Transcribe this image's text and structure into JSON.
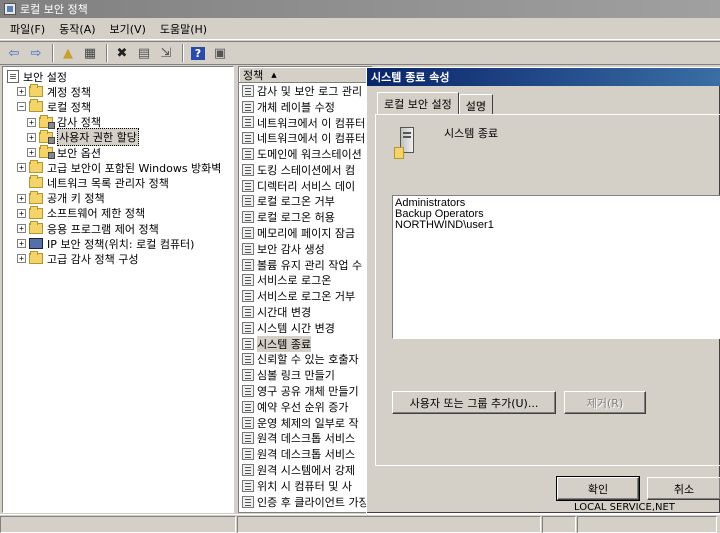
{
  "window": {
    "title": "로컬 보안 정책"
  },
  "menu": [
    "파일(F)",
    "동작(A)",
    "보기(V)",
    "도움말(H)"
  ],
  "toolbar": {
    "buttons": [
      {
        "icon": "back-arrow-icon",
        "glyph": "⇦",
        "color": "#3b6cc4"
      },
      {
        "icon": "forward-arrow-icon",
        "glyph": "⇨",
        "color": "#3b6cc4"
      },
      {
        "icon": "up-folder-icon",
        "glyph": "▲",
        "color": "#c8a030"
      },
      {
        "icon": "show-hide-tree-icon",
        "glyph": "▦",
        "color": "#444444"
      },
      {
        "icon": "delete-icon",
        "glyph": "✖",
        "color": "#222222"
      },
      {
        "icon": "properties-icon",
        "glyph": "▤",
        "color": "#555555"
      },
      {
        "icon": "export-list-icon",
        "glyph": "⇲",
        "color": "#555555"
      },
      {
        "icon": "help-icon",
        "glyph": "?",
        "color": "#ffffff"
      },
      {
        "icon": "console-icon",
        "glyph": "▣",
        "color": "#555555"
      }
    ]
  },
  "tree": {
    "items": [
      {
        "label": "보안 설정",
        "expander": "",
        "icon": "doc",
        "level": 0
      },
      {
        "label": "계정 정책",
        "expander": "+",
        "icon": "folder",
        "level": 1
      },
      {
        "label": "로컬 정책",
        "expander": "−",
        "icon": "folder",
        "level": 1
      },
      {
        "label": "감사 정책",
        "expander": "+",
        "icon": "lock-folder",
        "level": 2
      },
      {
        "label": "사용자 권한 할당",
        "expander": "+",
        "icon": "lock-folder",
        "level": 2,
        "selected": true
      },
      {
        "label": "보안 옵션",
        "expander": "+",
        "icon": "lock-folder",
        "level": 2
      },
      {
        "label": "고급 보안이 포함된 Windows 방화벽",
        "expander": "+",
        "icon": "folder",
        "level": 1
      },
      {
        "label": "네트워크 목록 관리자 정책",
        "expander": "",
        "icon": "folder",
        "level": 1
      },
      {
        "label": "공개 키 정책",
        "expander": "+",
        "icon": "folder",
        "level": 1
      },
      {
        "label": "소프트웨어 제한 정책",
        "expander": "+",
        "icon": "folder",
        "level": 1
      },
      {
        "label": "응용 프로그램 제어 정책",
        "expander": "+",
        "icon": "folder",
        "level": 1
      },
      {
        "label": "IP 보안 정책(위치: 로컬 컴퓨터)",
        "expander": "+",
        "icon": "pc",
        "level": 1
      },
      {
        "label": "고급 감사 정책 구성",
        "expander": "+",
        "icon": "folder",
        "level": 1
      }
    ]
  },
  "policy_list": {
    "header": "정책",
    "sort_indicator": "▲",
    "rows": [
      "감사 및 보안 로그 관리",
      "개체 레이블 수정",
      "네트워크에서 이 컴퓨터",
      "네트워크에서 이 컴퓨터",
      "도메인에 워크스테이션",
      "도킹 스테이션에서 컴",
      "디렉터리 서비스 데이",
      "로컬 로그온 거부",
      "로컬 로그온 허용",
      "메모리에 페이지 잠금",
      "보안 감사 생성",
      "볼륨 유지 관리 작업 수",
      "서비스로 로그온",
      "서비스로 로그온 거부",
      "시간대 변경",
      "시스템 시간 변경",
      "시스템 종료",
      "신뢰할 수 있는 호출자",
      "심볼 링크 만들기",
      "영구 공유 개체 만들기",
      "예약 우선 순위 증가",
      "운영 체제의 일부로 작",
      "원격 데스크톱 서비스",
      "원격 데스크톱 서비스",
      "원격 시스템에서 강제",
      "위치 시 컴퓨터 및 사",
      "인증 후 클라이언트 가장"
    ],
    "selected_index": 16
  },
  "dialog": {
    "title": "시스템 종료 속성",
    "tabs": [
      "로컬 보안 설정",
      "설명"
    ],
    "active_tab": 0,
    "policy_name": "시스템 종료",
    "members": [
      "Administrators",
      "Backup Operators",
      "NORTHWIND\\user1"
    ],
    "add_button": "사용자 또는 그룹 추가(U)...",
    "remove_button": "제거(R)",
    "ok_button": "확인",
    "cancel_button": "취소"
  },
  "status": {
    "right_text": "LOCAL SERVICE,NET"
  }
}
